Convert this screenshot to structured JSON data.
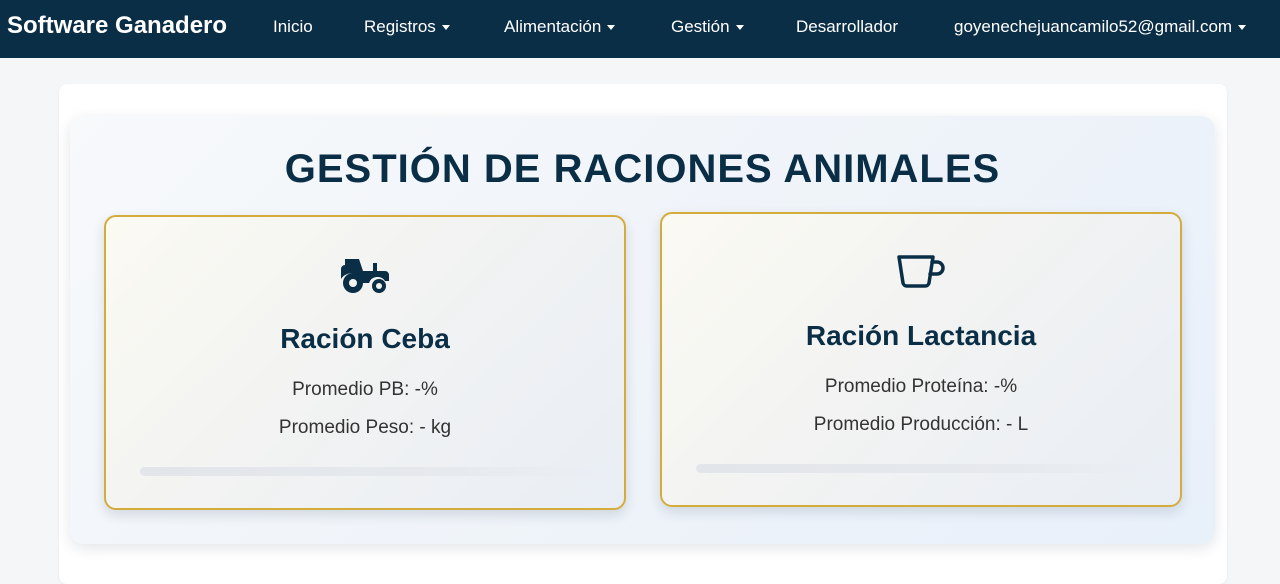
{
  "navbar": {
    "brand": "Software Ganadero",
    "items": [
      {
        "label": "Inicio",
        "dropdown": false
      },
      {
        "label": "Registros",
        "dropdown": true
      },
      {
        "label": "Alimentación",
        "dropdown": true
      },
      {
        "label": "Gestión",
        "dropdown": true
      },
      {
        "label": "Desarrollador",
        "dropdown": false
      }
    ],
    "user": {
      "label": "goyenechejuancamilo52@gmail.com",
      "dropdown": true
    },
    "background_color": "#0b2e47"
  },
  "main": {
    "title": "GESTIÓN DE RACIONES ANIMALES",
    "cards": [
      {
        "icon": "tractor-icon",
        "title": "Ración Ceba",
        "lines": [
          "Promedio PB: -%",
          "Promedio Peso: - kg"
        ],
        "progress": 0
      },
      {
        "icon": "cup-icon",
        "title": "Ración Lactancia",
        "lines": [
          "Promedio Proteína: -%",
          "Promedio Producción: - L"
        ],
        "progress": 0
      }
    ]
  },
  "colors": {
    "primary": "#0b2e47",
    "card_border": "#d4ac3c"
  }
}
